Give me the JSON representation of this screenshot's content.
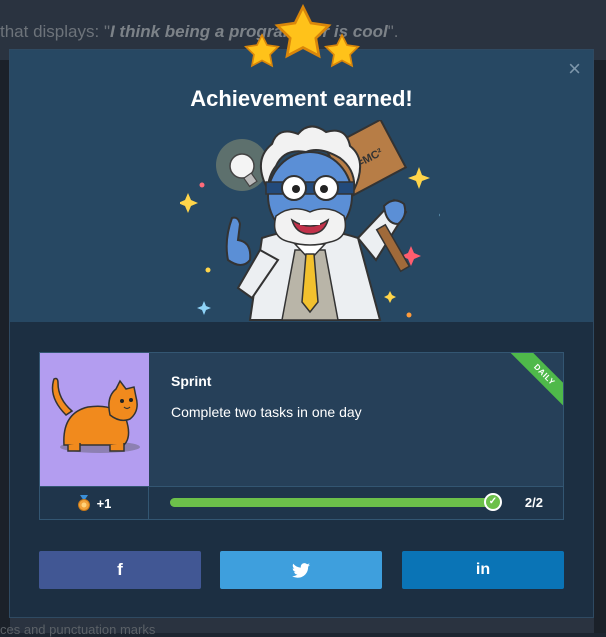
{
  "background": {
    "top_text_prefix": "that displays: \"",
    "top_text_quote": "I think being a programmer is cool",
    "top_text_suffix": "\".",
    "bottom_text": "ces and punctuation marks"
  },
  "modal": {
    "title": "Achievement earned!",
    "close_icon": "×"
  },
  "achievement": {
    "name": "Sprint",
    "description": "Complete two tasks in one day",
    "ribbon": "DAILY",
    "reward": "+1",
    "progress_fraction": 1.0,
    "progress_text": "2/2"
  },
  "share": {
    "facebook_icon": "f",
    "twitter_icon": "twitter-bird",
    "linkedin_icon": "in"
  },
  "colors": {
    "accent_green": "#6cc04a",
    "facebook": "#415794",
    "twitter": "#3e9fdd",
    "linkedin": "#0a74b6",
    "star": "#ffc21a"
  }
}
